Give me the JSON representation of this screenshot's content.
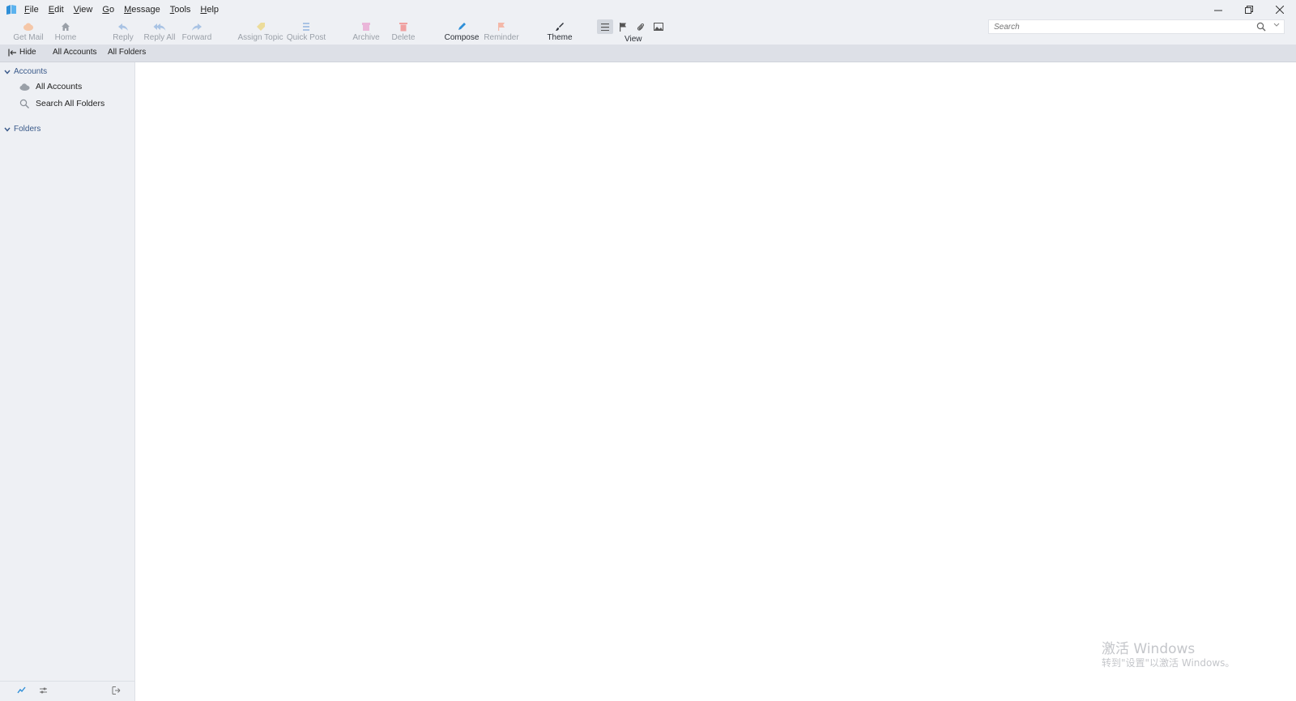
{
  "menu": [
    {
      "pre": "",
      "ul": "F",
      "post": "ile"
    },
    {
      "pre": "",
      "ul": "E",
      "post": "dit"
    },
    {
      "pre": "",
      "ul": "V",
      "post": "iew"
    },
    {
      "pre": "",
      "ul": "G",
      "post": "o"
    },
    {
      "pre": "",
      "ul": "M",
      "post": "essage"
    },
    {
      "pre": "",
      "ul": "T",
      "post": "ools"
    },
    {
      "pre": "",
      "ul": "H",
      "post": "elp"
    }
  ],
  "toolbar": {
    "get_mail": "Get Mail",
    "home": "Home",
    "reply": "Reply",
    "reply_all": "Reply All",
    "forward": "Forward",
    "assign_topic": "Assign Topic",
    "quick_post": "Quick Post",
    "archive": "Archive",
    "delete": "Delete",
    "compose": "Compose",
    "reminder": "Reminder",
    "theme": "Theme",
    "view": "View"
  },
  "search": {
    "placeholder": "Search"
  },
  "subbar": {
    "hide": "Hide",
    "all_accounts": "All Accounts",
    "all_folders": "All Folders"
  },
  "sidebar": {
    "accounts_header": "Accounts",
    "all_accounts": "All Accounts",
    "search_all_folders": "Search All Folders",
    "folders_header": "Folders"
  },
  "watermark": {
    "line1": "激活 Windows",
    "line2": "转到\"设置\"以激活 Windows。"
  },
  "colors": {
    "accent": "#2f8fd8",
    "topbar_bg": "#eef0f4",
    "subbar_bg": "#dde0e7"
  }
}
